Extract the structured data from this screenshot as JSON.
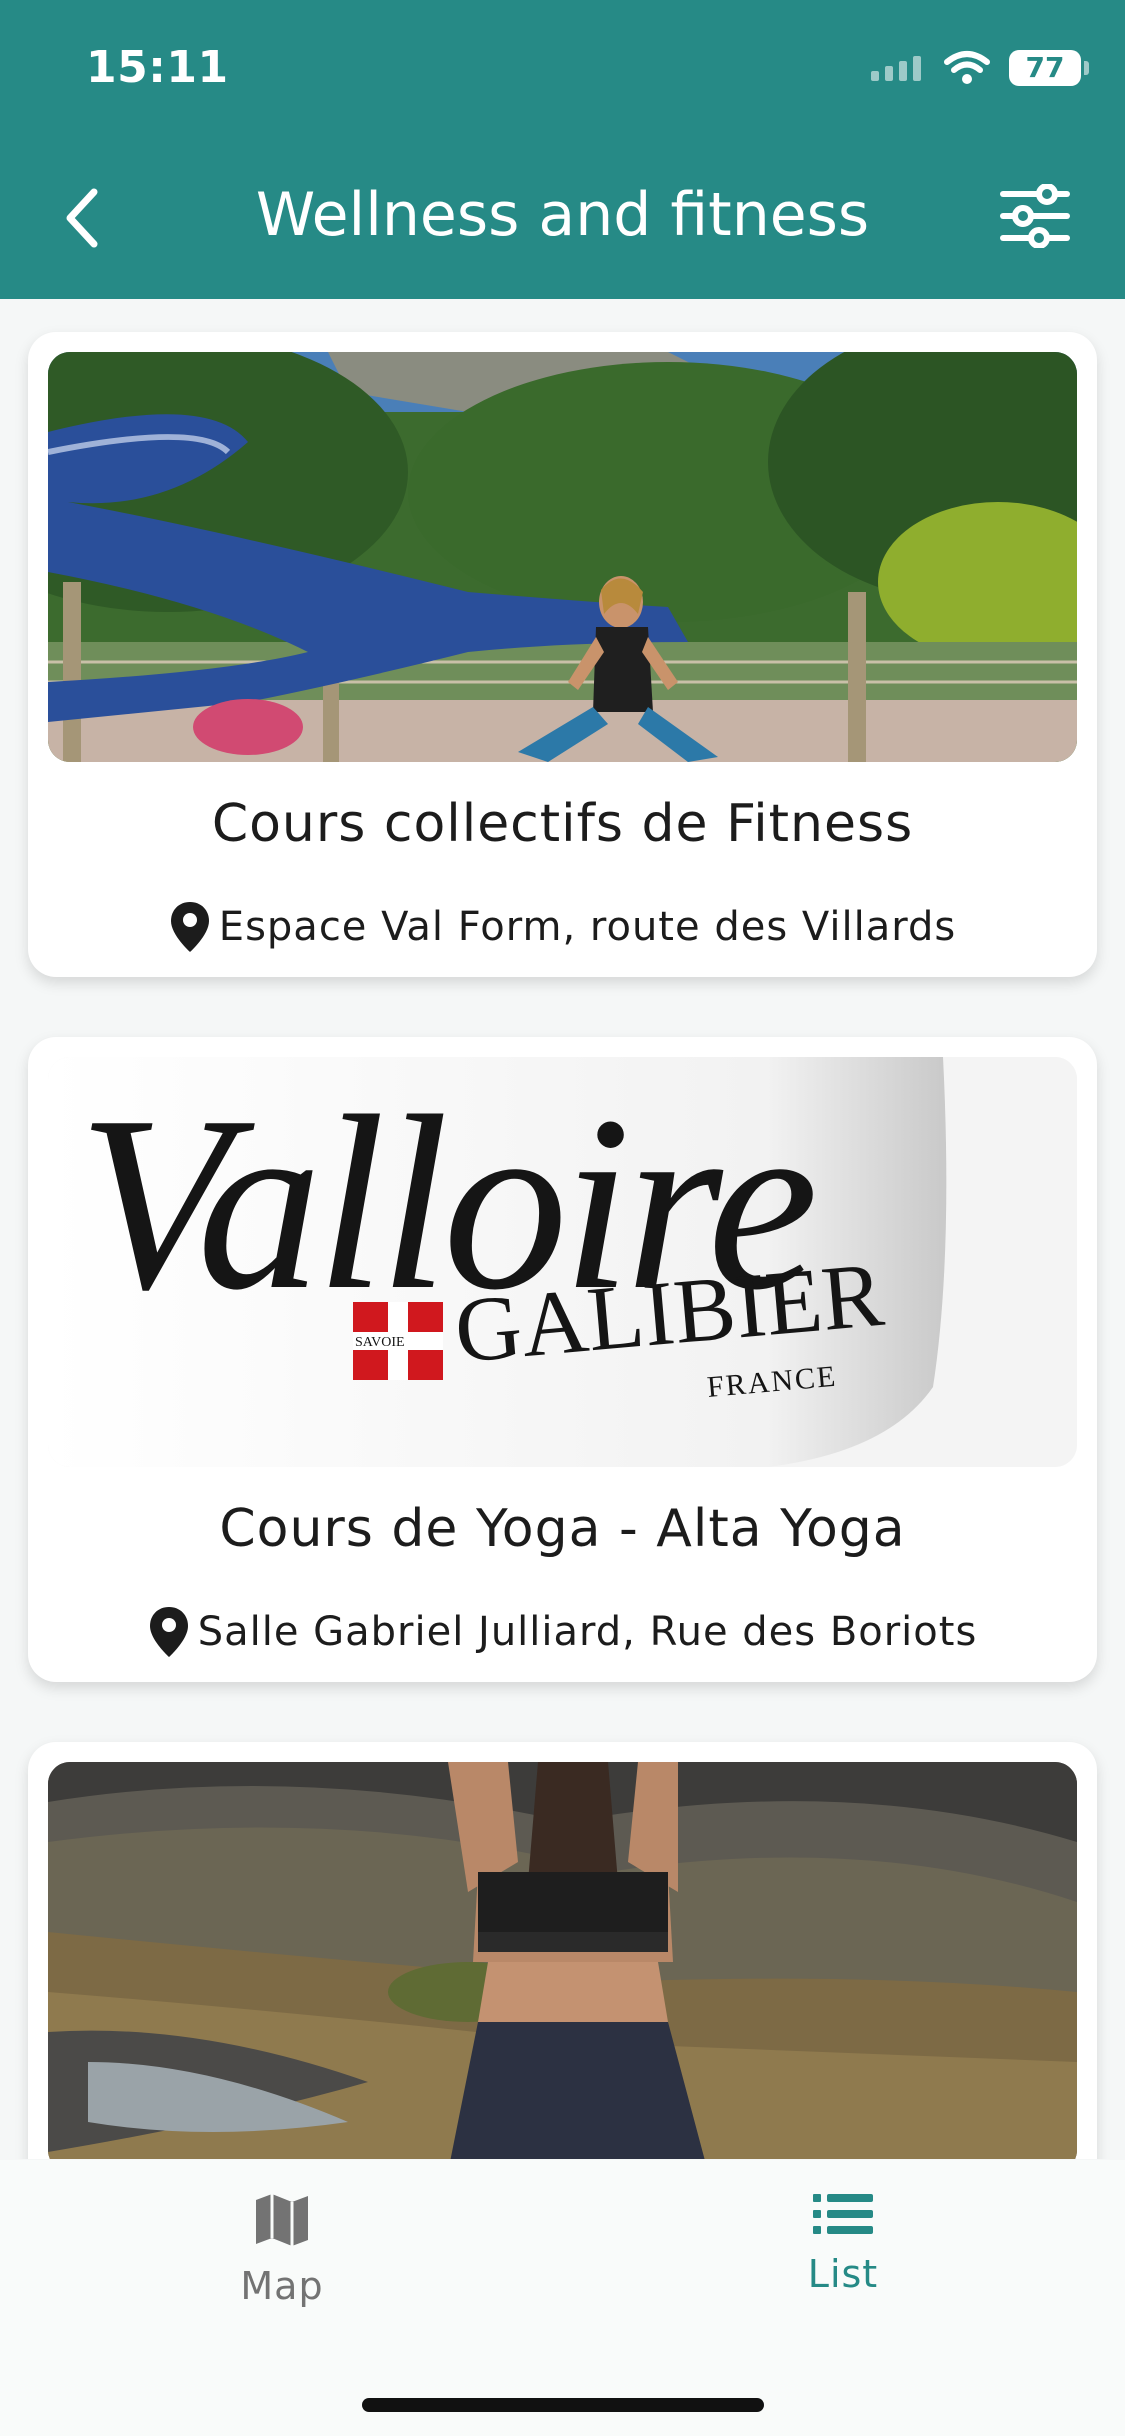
{
  "status_bar": {
    "time": "15:11",
    "battery": "77"
  },
  "header": {
    "title": "Wellness and fitness",
    "back_icon": "chevron-left-icon",
    "filter_icon": "sliders-icon"
  },
  "cards": [
    {
      "title": "Cours collectifs de Fitness",
      "location": "Espace Val Form, route des Villards",
      "image": "fitness instructor stretching by water slide"
    },
    {
      "title": "Cours de Yoga - Alta Yoga",
      "location": "Salle Gabriel Julliard, Rue des Boriots"
    },
    {
      "title": "",
      "location": "",
      "image": "yoga pose by mountain stream"
    }
  ],
  "logo": {
    "valloire": "Valloire",
    "galibier": "GALIBIER",
    "france": "FRANCE",
    "savoie": "SAVOIE"
  },
  "tabbar": {
    "tabs": [
      {
        "label": "Map",
        "icon": "map-icon",
        "active": false
      },
      {
        "label": "List",
        "icon": "list-icon",
        "active": true
      }
    ]
  },
  "colors": {
    "brand": "#268a86",
    "inactive": "#737373"
  }
}
